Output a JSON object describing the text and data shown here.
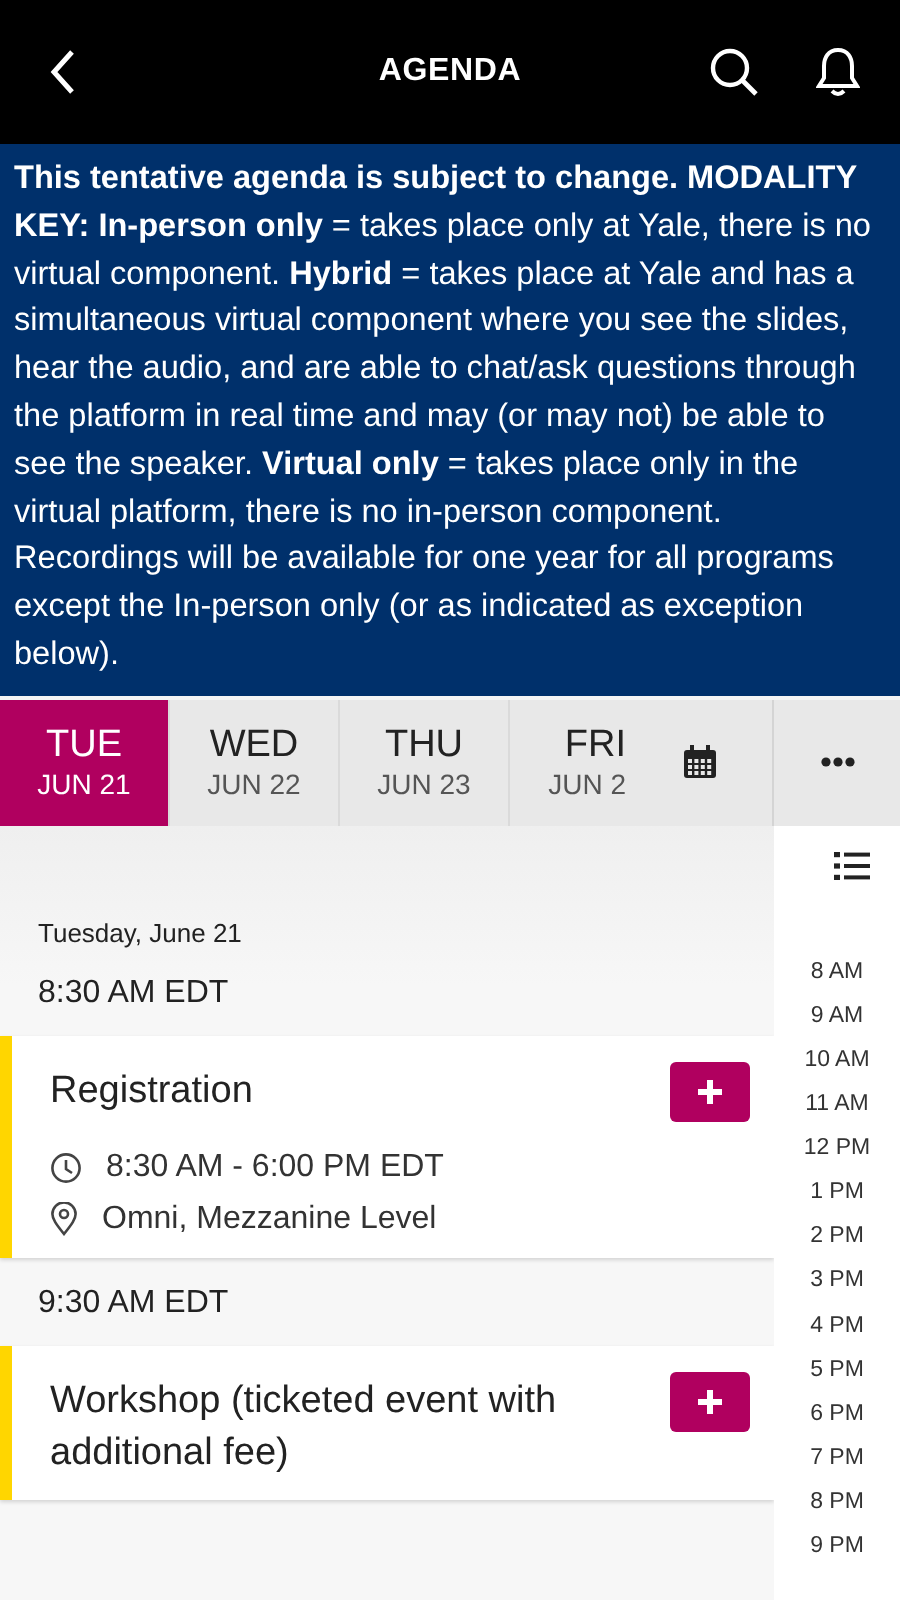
{
  "header": {
    "title": "AGENDA"
  },
  "notice": "**This tentative agenda is subject to change. MODALITY KEY:  In-person only** = takes place only at Yale, there is no virtual component. **Hybrid** = takes place at Yale and has a simultaneous virtual component where you see the slides, hear the audio, and are able to chat/ask questions through the platform in real time and may (or may not) be able to see the speaker. **Virtual only** =  takes place only in the virtual platform, there is no in-person component.  Recordings will be available for one year for all programs except the In-person only (or as indicated as exception below).",
  "day_tabs": [
    {
      "day": "TUE",
      "date": "JUN 21",
      "selected": true
    },
    {
      "day": "WED",
      "date": "JUN 22",
      "selected": false
    },
    {
      "day": "THU",
      "date": "JUN 23",
      "selected": false
    },
    {
      "day": "FRI",
      "date": "JUN 2",
      "selected": false
    }
  ],
  "date_heading": "Tuesday, June 21",
  "time_groups": [
    {
      "time": "8:30 AM EDT",
      "events": [
        {
          "title": "Registration",
          "color": "#ffd600",
          "time": "8:30 AM - 6:00 PM EDT",
          "location": "Omni, Mezzanine Level"
        }
      ]
    },
    {
      "time": "9:30 AM EDT",
      "events": [
        {
          "title": "Workshop (ticketed event with additional fee)",
          "color": "#ffd600"
        }
      ]
    }
  ],
  "hour_index": [
    "8 AM",
    "9 AM",
    "10 AM",
    "11 AM",
    "12 PM",
    "1 PM",
    "2 PM",
    "3 PM",
    "4 PM",
    "5 PM",
    "6 PM",
    "7 PM",
    "8 PM",
    "9 PM"
  ]
}
